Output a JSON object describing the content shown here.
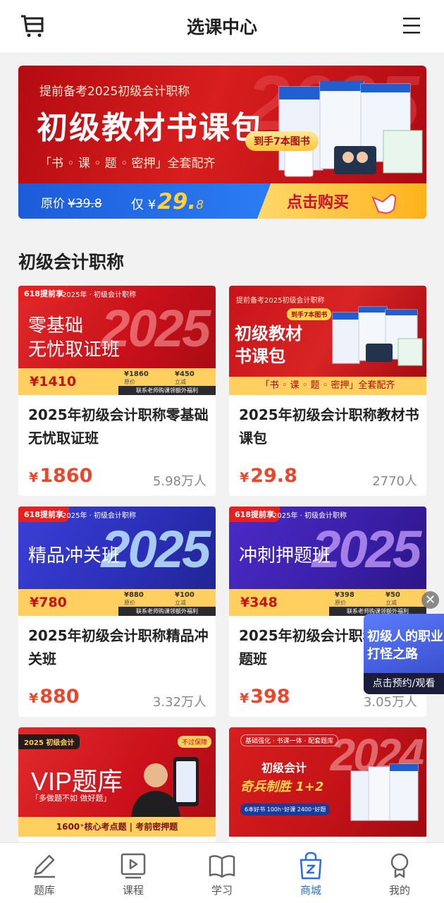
{
  "header": {
    "title": "选课中心",
    "cart_icon": "shopping-cart-icon",
    "menu_icon": "hamburger-menu-icon"
  },
  "banner": {
    "subtitle": "提前备考2025初级会计职称",
    "title": "初级教材书课包",
    "features": "「书 ◦ 课 ◦ 题 ◦ 密押」全套配齐",
    "books_badge": "到手7本图书",
    "original_label": "原价",
    "original_price": "¥39.8",
    "now_label": "仅",
    "now_currency": "¥",
    "now_price": "29.",
    "now_decimal": "8",
    "buy_label": "点击购买",
    "year_watermark": "2025"
  },
  "section": {
    "title": "初级会计职称"
  },
  "courses": [
    {
      "name": "2025年初级会计职称零基础无忧取证班",
      "price": "1860",
      "learners": "5.98万人",
      "thumb": {
        "tag": "618提前享",
        "tag_year": "2025年 · 初级会计职称",
        "title_line1": "零基础",
        "title_line2": "无忧取证班",
        "year": "2025",
        "sale_price": "¥1410",
        "orig_price": "¥1860",
        "orig_label": "原价",
        "discount": "¥450",
        "discount_label": "立减",
        "footer": "联系老师购课领额外福利"
      }
    },
    {
      "name": "2025年初级会计职称教材书课包",
      "price": "29.8",
      "learners": "2770人",
      "thumb": {
        "subtitle": "提前备考2025初级会计职称",
        "title_line1": "初级教材",
        "title_line2": "书课包",
        "badge": "到手7本图书",
        "footer": "「书 ◦ 课 ◦ 题 ◦ 密押」全套配齐"
      }
    },
    {
      "name": "2025年初级会计职称精品冲关班",
      "price": "880",
      "learners": "3.32万人",
      "thumb": {
        "tag": "618提前享",
        "tag_year": "2025年 · 初级会计职称",
        "title_line1": "精品冲关班",
        "year": "2025",
        "sale_price": "¥780",
        "orig_price": "¥880",
        "orig_label": "原价",
        "discount": "¥100",
        "discount_label": "立减",
        "footer": "联系老师购课领额外福利"
      }
    },
    {
      "name": "2025年初级会计职称冲刺押题班",
      "price": "398",
      "learners": "3.05万人",
      "thumb": {
        "tag": "618提前享",
        "tag_year": "2025年 · 初级会计职称",
        "title_line1": "冲刺押题班",
        "year": "2025",
        "sale_price": "¥348",
        "orig_price": "¥398",
        "orig_label": "原价",
        "discount": "¥50",
        "discount_label": "立减",
        "footer": "联系老师购课领额外福利"
      }
    },
    {
      "thumb": {
        "tag": "2025 初级会计",
        "corner_tag": "不过保障",
        "title_line1": "VIP题库",
        "slogan": "「多做题不如 做好题」",
        "footer": "1600⁺核心考点题 | 考前密押题"
      }
    },
    {
      "thumb": {
        "subtitle": "基础强化 · 书课一体 · 配套题库",
        "title_line1": "初级会计",
        "title_line2": "奇兵制胜 1+2",
        "badge": "6本好书  100h⁺好课  2400⁺好题",
        "year": "2024"
      }
    }
  ],
  "float_ad": {
    "line1": "初级人的职业",
    "line2": "打怪之路",
    "cta": "点击预约/观看",
    "close_label": "✕"
  },
  "nav": [
    {
      "label": "题库",
      "icon": "pen-icon",
      "active": false
    },
    {
      "label": "课程",
      "icon": "play-icon",
      "active": false
    },
    {
      "label": "学习",
      "icon": "book-icon",
      "active": false
    },
    {
      "label": "商城",
      "icon": "shopping-bag-icon",
      "active": true
    },
    {
      "label": "我的",
      "icon": "user-icon",
      "active": false
    }
  ],
  "colors": {
    "accent": "#2a6de0",
    "price": "#e9472b",
    "banner_red": "#c81418"
  }
}
